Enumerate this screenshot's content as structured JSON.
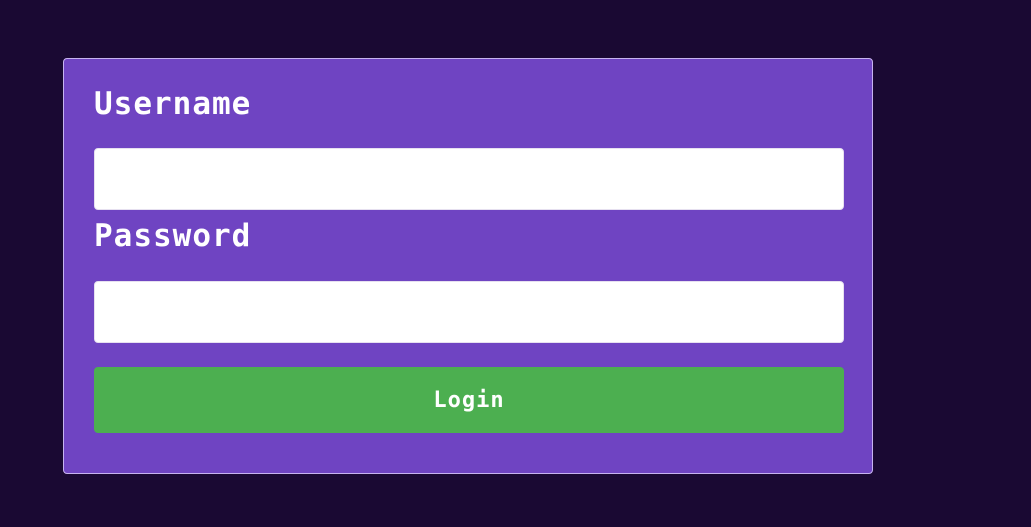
{
  "login_form": {
    "username_label": "Username",
    "username_value": "",
    "password_label": "Password",
    "password_value": "",
    "login_button_label": "Login"
  },
  "colors": {
    "page_background": "#1a0933",
    "card_background": "#6f44c2",
    "button_background": "#4caf50",
    "label_text": "#ffffff"
  }
}
